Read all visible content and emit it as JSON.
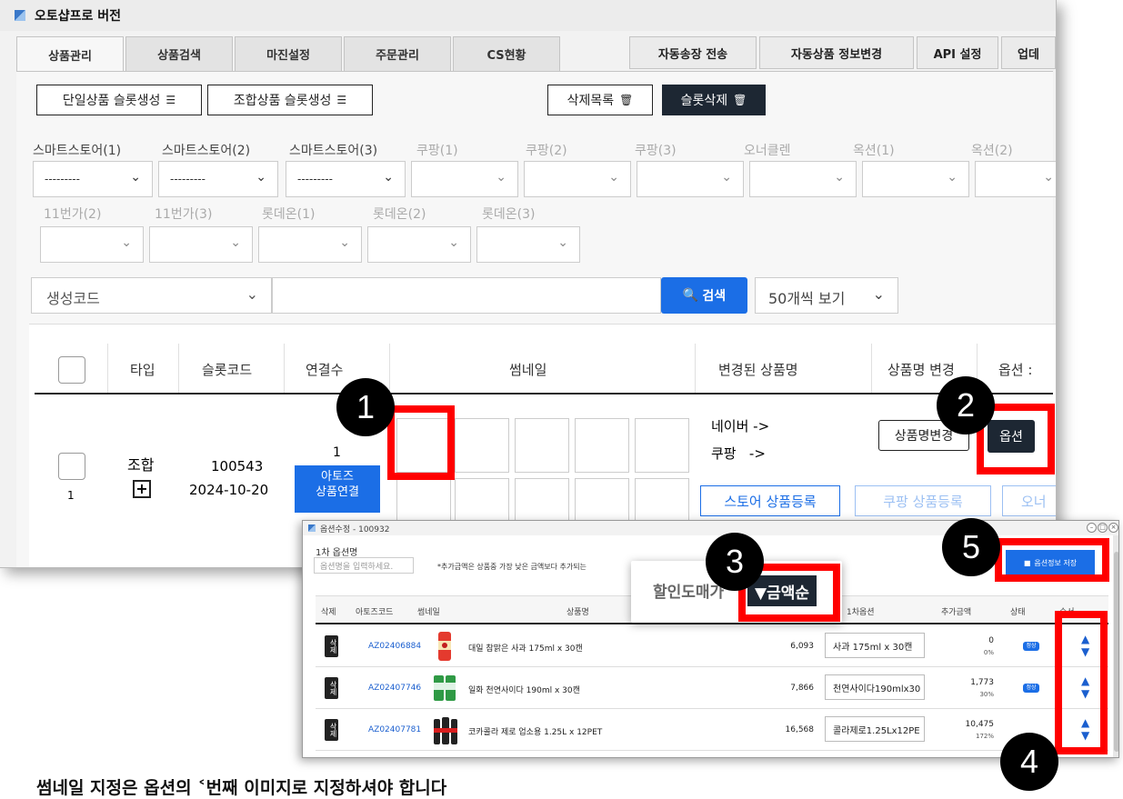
{
  "window": {
    "title": "오토샵프로 버전"
  },
  "tabs": [
    "상품관리",
    "상품검색",
    "마진설정",
    "주문관리",
    "CS현황"
  ],
  "right_tabs": [
    "자동송장 전송",
    "자동상품 정보변경",
    "API 설정",
    "업데"
  ],
  "toolbar": {
    "single_slot": "단일상품 슬롯생성",
    "combo_slot": "조합상품 슬롯생성",
    "delete_list": "삭제목록",
    "slot_delete": "슬롯삭제"
  },
  "stores_row1": [
    "스마트스토어(1)",
    "스마트스토어(2)",
    "스마트스토어(3)",
    "쿠팡(1)",
    "쿠팡(2)",
    "쿠팡(3)",
    "오너클렌",
    "옥션(1)",
    "옥션(2)"
  ],
  "stores_row2": [
    "11번가(2)",
    "11번가(3)",
    "롯데온(1)",
    "롯데온(2)",
    "롯데온(3)"
  ],
  "dropdown_default": "---------",
  "search": {
    "field": "생성코드",
    "button": "검색",
    "per_page": "50개씩 보기"
  },
  "table": {
    "headers": [
      "타입",
      "슬롯코드",
      "연결수",
      "썸네일",
      "변경된 상품명",
      "상품명 변경",
      "옵션 :"
    ],
    "row": {
      "index": "1",
      "type": "조합",
      "slot_code": "100543",
      "date": "2024-10-20",
      "count": "1",
      "link_button_line1": "아토즈",
      "link_button_line2": "상품연결",
      "naver": "네이버 ->",
      "coupang": "쿠팡   ->",
      "rename_button": "상품명변경",
      "option_button": "옵션",
      "store_register": "스토어 상품등록",
      "coupang_register": "쿠팡 상품등록",
      "more": "오너"
    }
  },
  "popup": {
    "title": "옵션수정 - 100932",
    "first_option_label": "1차 옵션명",
    "first_option_placeholder": "옵션명을 입력하세요.",
    "note": "*추가금액은 상품중 가장 낮은 금액보다 추가되는",
    "save_button": "옵션정보 저장",
    "headers": [
      "삭제",
      "아토즈코드",
      "썸네일",
      "상품명",
      "1차옵션",
      "추가금액",
      "상태",
      "순서"
    ],
    "rows": [
      {
        "code": "AZ02406884",
        "name": "대일 참맑은 사과 175ml x 30캔",
        "price": "6,093",
        "option": "사과 175ml x 30캔",
        "add": "0",
        "pct": "0%",
        "status": "정상"
      },
      {
        "code": "AZ02407746",
        "name": "일화 천연사이다 190ml x 30캔",
        "price": "7,866",
        "option": "천연사이다190mlx30",
        "add": "1,773",
        "pct": "30%",
        "status": "정상"
      },
      {
        "code": "AZ02407781",
        "name": "코카콜라 제로 업소용 1.25L x 12PET",
        "price": "16,568",
        "option": "콜라제로1.25Lx12PE",
        "add": "10,475",
        "pct": "172%",
        "status": ""
      }
    ],
    "delete_label": "삭제"
  },
  "sort_zoom": {
    "label": "할인도매가",
    "button": "▼금액순"
  },
  "markers": [
    "1",
    "2",
    "3",
    "4",
    "5"
  ],
  "caption": "썸네일 지정은 옵션의 ˂번째 이미지로 지정하셔야 합니다"
}
